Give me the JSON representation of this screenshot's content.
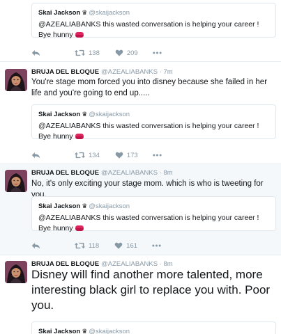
{
  "tweets": [
    {
      "quote": {
        "name": "Skai Jackson",
        "crown": "♛",
        "handle": "@skaijackson",
        "text": "@AZEALIABANKS this wasted conversation is helping your career ! Bye hunny"
      },
      "retweets": "138",
      "likes": "209"
    },
    {
      "name": "BRUJA DEL BLOQUE",
      "handle": "@AZEALIABANKS",
      "time": "· 7m",
      "text": "You're stage mom forced you into disney because she failed in her life and you're going to end up.....",
      "quote": {
        "name": "Skai Jackson",
        "crown": "♛",
        "handle": "@skaijackson",
        "text": "@AZEALIABANKS this wasted conversation is helping your career ! Bye hunny"
      },
      "retweets": "134",
      "likes": "173"
    },
    {
      "name": "BRUJA DEL BLOQUE",
      "handle": "@AZEALIABANKS",
      "time": "· 8m",
      "text": "No, it's only exciting your stage mom. which is who is tweeting for you.",
      "quote": {
        "name": "Skai Jackson",
        "crown": "♛",
        "handle": "@skaijackson",
        "text": "@AZEALIABANKS this wasted conversation is helping your career ! Bye hunny"
      },
      "retweets": "118",
      "likes": "161"
    },
    {
      "name": "BRUJA DEL BLOQUE",
      "handle": "@AZEALIABANKS",
      "time": "· 8m",
      "text": "Disney will find another more talented, more interesting black girl to replace you with. Poor you.",
      "quote": {
        "name": "Skai Jackson",
        "crown": "♛",
        "handle": "@skaijackson"
      }
    }
  ],
  "colors": {
    "text": "#14171a",
    "muted": "#8899a6",
    "border": "#e1e8ed",
    "highlight_bg": "#f5f8fa",
    "kiss": "#e0245e"
  },
  "icons": [
    "reply-icon",
    "retweet-icon",
    "heart-icon",
    "more-icon",
    "crown-icon",
    "kiss-emoji-icon"
  ]
}
